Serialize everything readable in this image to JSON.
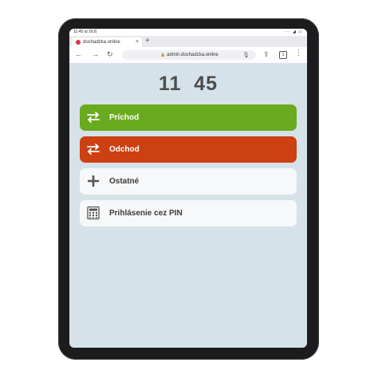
{
  "status_bar": {
    "time": "11:45",
    "date": "ut 16.8.",
    "indicators": "···  ◢ ▭"
  },
  "browser": {
    "tab_title": "dochadzka.online",
    "tab_close": "×",
    "new_tab": "+",
    "back": "←",
    "forward": "→",
    "reload": "↻",
    "url": "admin.dochadzka.online",
    "lock": "🔒",
    "mic": "🎙",
    "share": "⇪",
    "tab_count": "1",
    "menu": "⋮"
  },
  "clock": {
    "hours": "11",
    "minutes": "45"
  },
  "actions": {
    "arrival": {
      "label": "Príchod",
      "icon": "swap-arrows-icon",
      "color": "#6aaa1e"
    },
    "departure": {
      "label": "Odchod",
      "icon": "swap-arrows-icon",
      "color": "#cc4011"
    },
    "other": {
      "label": "Ostatné",
      "icon": "plus-icon"
    },
    "pin_login": {
      "label": "Prihlásenie cez PIN",
      "icon": "calculator-icon"
    }
  }
}
